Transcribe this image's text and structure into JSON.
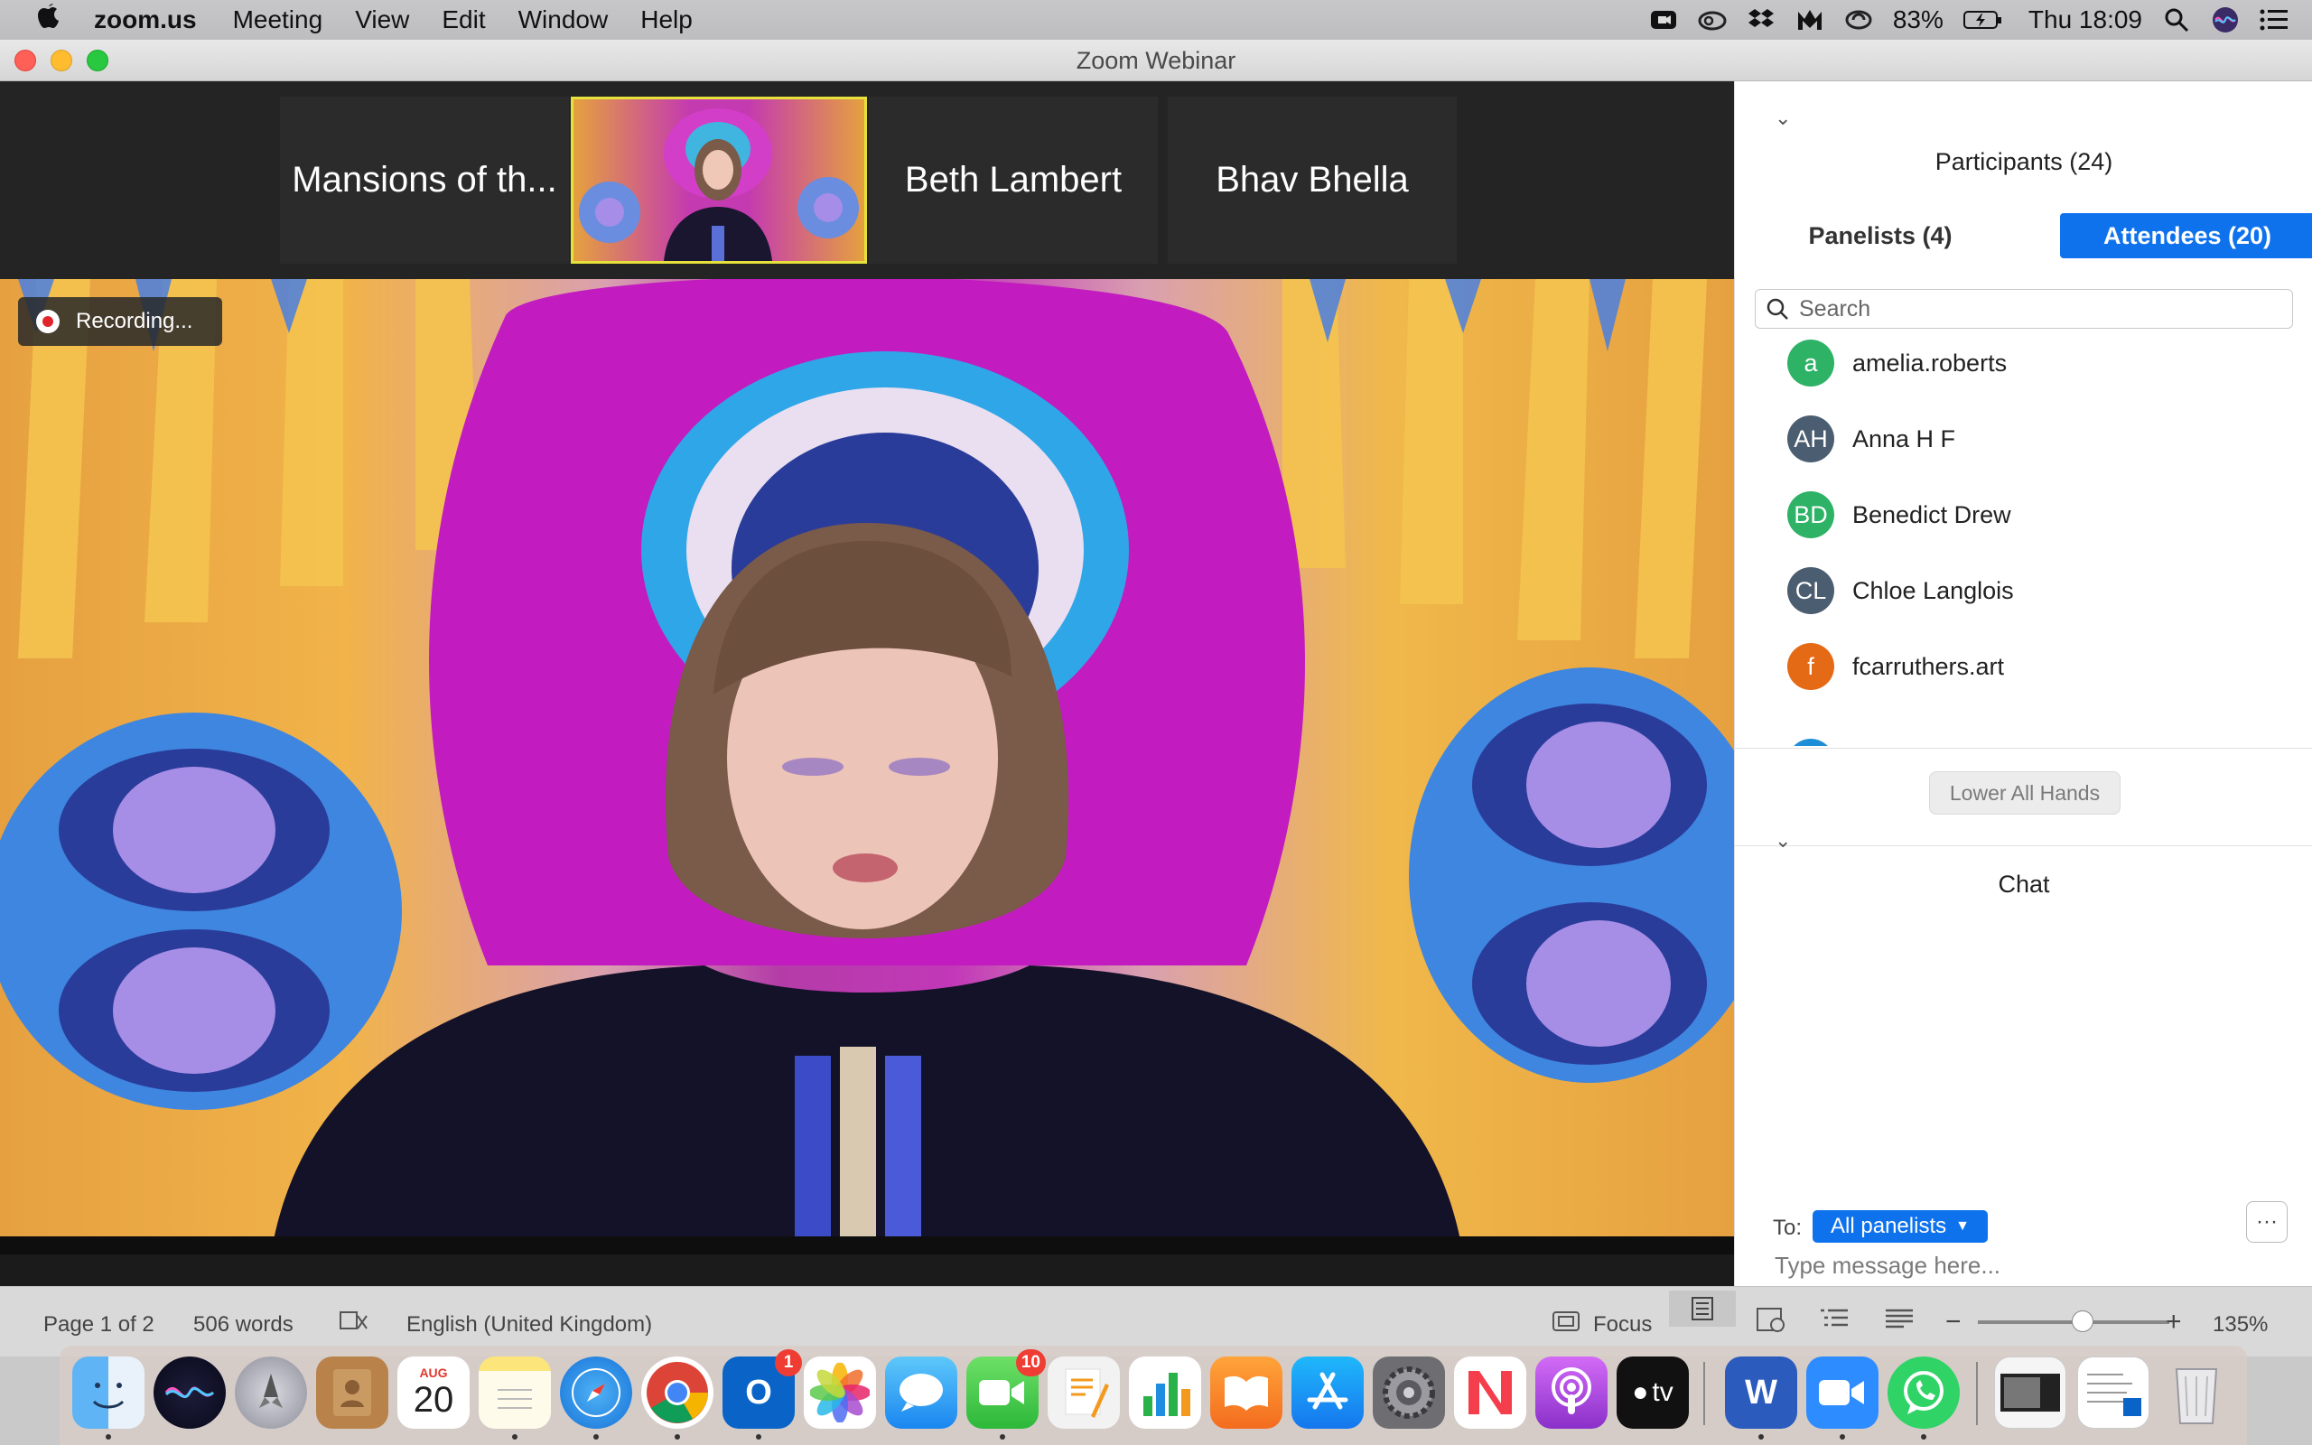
{
  "menubar": {
    "app_name": "zoom.us",
    "menus": [
      "Meeting",
      "View",
      "Edit",
      "Window",
      "Help"
    ],
    "battery": "83%",
    "clock": "Thu 18:09"
  },
  "window": {
    "title": "Zoom Webinar"
  },
  "video": {
    "tiles": [
      "Mansions of th...",
      "Beth Lambert",
      "Bhav Bhella"
    ],
    "recording_label": "Recording..."
  },
  "participants": {
    "header": "Participants (24)",
    "tab_panelists": "Panelists (4)",
    "tab_attendees": "Attendees (20)",
    "search_placeholder": "Search",
    "list": [
      {
        "initials": "a",
        "name": "amelia.roberts",
        "color": "#2db266"
      },
      {
        "initials": "AH",
        "name": "Anna H F",
        "color": "#4b5d70"
      },
      {
        "initials": "BD",
        "name": "Benedict Drew",
        "color": "#2db266"
      },
      {
        "initials": "CL",
        "name": "Chloe Langlois",
        "color": "#4b5d70"
      },
      {
        "initials": "f",
        "name": "fcarruthers.art",
        "color": "#e46a16"
      }
    ],
    "lower_all_hands": "Lower All Hands"
  },
  "chat": {
    "header": "Chat",
    "to_label": "To:",
    "to_value": "All panelists",
    "message_placeholder": "Type message here..."
  },
  "word_status": {
    "page": "Page 1 of 2",
    "words": "506 words",
    "language": "English (United Kingdom)",
    "focus": "Focus",
    "zoom": "135%"
  },
  "dock": {
    "calendar_month": "AUG",
    "calendar_day": "20",
    "outlook_badge": "1",
    "facetime_badge": "10",
    "tv_label": "tv"
  },
  "colors": {
    "accent": "#0e72ed",
    "tile_bg": "#2b2b2b",
    "active_tile_border": "#e7e13b"
  }
}
